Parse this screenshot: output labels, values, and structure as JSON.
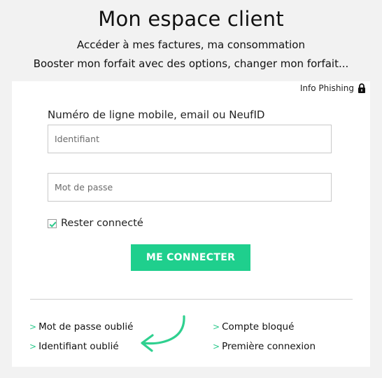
{
  "header": {
    "title": "Mon espace client",
    "subtitle_line1": "Accéder à mes factures, ma consommation",
    "subtitle_line2": "Booster mon forfait avec des options, changer mon forfait..."
  },
  "card": {
    "info_phishing_label": "Info Phishing",
    "lock_icon": "lock-icon",
    "identifier_label": "Numéro de ligne mobile, email ou NeufID",
    "identifier_value": "",
    "identifier_placeholder": "Identifiant",
    "password_value": "",
    "password_placeholder": "Mot de passe",
    "remember_label": "Rester connecté",
    "remember_checked": true,
    "connect_button_label": "ME CONNECTER",
    "chevron": ">",
    "links": {
      "forgot_password": "Mot de passe oublié",
      "forgot_identifier": "Identifiant oublié",
      "account_blocked": "Compte bloqué",
      "first_connection": "Première connexion"
    }
  },
  "colors": {
    "accent": "#1fcf8d",
    "check": "#2cc98c",
    "background": "#f2f2f2",
    "card": "#ffffff"
  }
}
